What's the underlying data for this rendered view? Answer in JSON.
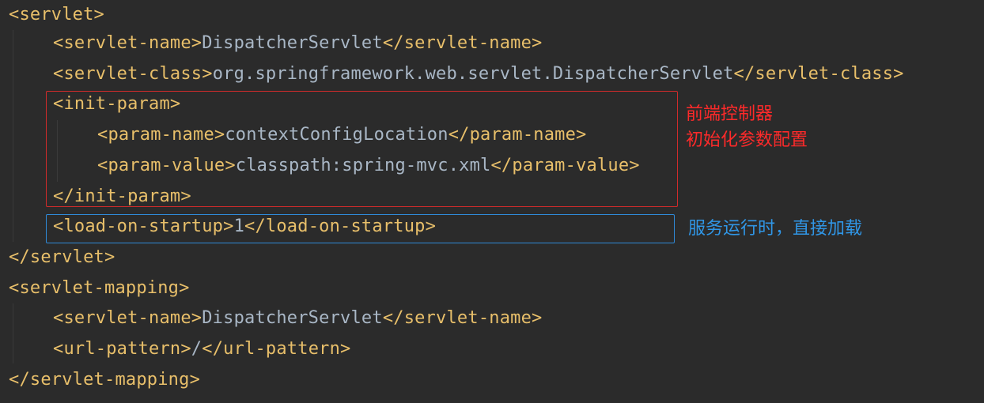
{
  "colors": {
    "background": "#2b2b2b",
    "tag": "#e8bf6a",
    "text": "#a9b7c6",
    "red_annotation": "#ff2a2a",
    "blue_annotation": "#3096e6"
  },
  "code": {
    "lines": [
      {
        "parts": [
          {
            "kind": "tag",
            "text": "<servlet>"
          }
        ]
      },
      {
        "parts": [
          {
            "kind": "tag",
            "text": "<servlet-name>"
          },
          {
            "kind": "text",
            "text": "DispatcherServlet"
          },
          {
            "kind": "tag",
            "text": "</servlet-name>"
          }
        ]
      },
      {
        "parts": [
          {
            "kind": "tag",
            "text": "<servlet-class>"
          },
          {
            "kind": "text",
            "text": "org.springframework.web.servlet.DispatcherServlet"
          },
          {
            "kind": "tag",
            "text": "</servlet-class>"
          }
        ]
      },
      {
        "parts": [
          {
            "kind": "tag",
            "text": "<init-param>"
          }
        ]
      },
      {
        "parts": [
          {
            "kind": "tag",
            "text": "<param-name>"
          },
          {
            "kind": "text",
            "text": "contextConfigLocation"
          },
          {
            "kind": "tag",
            "text": "</param-name>"
          }
        ]
      },
      {
        "parts": [
          {
            "kind": "tag",
            "text": "<param-value>"
          },
          {
            "kind": "text",
            "text": "classpath:spring-mvc.xml"
          },
          {
            "kind": "tag",
            "text": "</param-value>"
          }
        ]
      },
      {
        "parts": [
          {
            "kind": "tag",
            "text": "</init-param>"
          }
        ]
      },
      {
        "parts": [
          {
            "kind": "tag",
            "text": "<load-on-startup>"
          },
          {
            "kind": "text",
            "text": "1"
          },
          {
            "kind": "tag",
            "text": "</load-on-startup>"
          }
        ]
      },
      {
        "parts": [
          {
            "kind": "tag",
            "text": "</servlet>"
          }
        ]
      },
      {
        "parts": [
          {
            "kind": "tag",
            "text": "<servlet-mapping>"
          }
        ]
      },
      {
        "parts": [
          {
            "kind": "tag",
            "text": "<servlet-name>"
          },
          {
            "kind": "text",
            "text": "DispatcherServlet"
          },
          {
            "kind": "tag",
            "text": "</servlet-name>"
          }
        ]
      },
      {
        "parts": [
          {
            "kind": "tag",
            "text": "<url-pattern>"
          },
          {
            "kind": "text",
            "text": "/"
          },
          {
            "kind": "tag",
            "text": "</url-pattern>"
          }
        ]
      },
      {
        "parts": [
          {
            "kind": "tag",
            "text": "</servlet-mapping>"
          }
        ]
      }
    ]
  },
  "annotations": {
    "init_param_line1": "前端控制器",
    "init_param_line2": "初始化参数配置",
    "load_on_startup": "服务运行时，直接加载"
  }
}
